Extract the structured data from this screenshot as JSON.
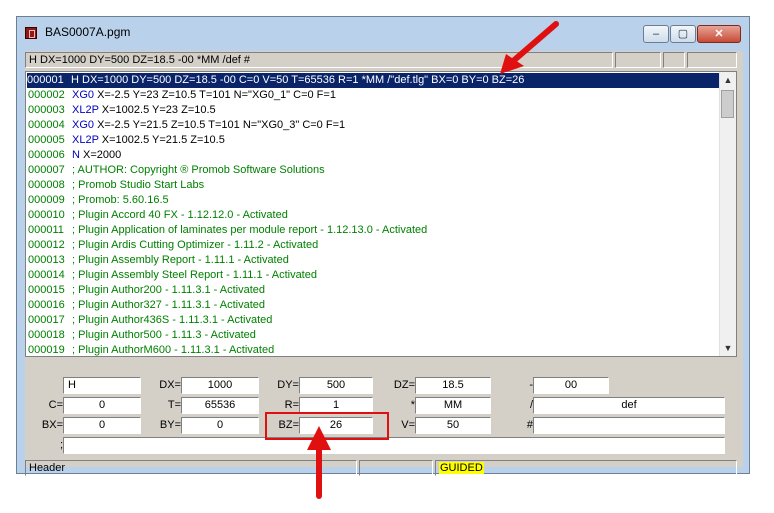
{
  "window": {
    "title": "BAS0007A.pgm",
    "controls": {
      "minimize": "–",
      "maximize": "▢",
      "close": "✕"
    }
  },
  "top_status": {
    "text": "H DX=1000 DY=500 DZ=18.5 -00 *MM /def #"
  },
  "lines": [
    {
      "num": "000001",
      "cmd": "H",
      "rest": "DX=1000 DY=500 DZ=18.5 -00 C=0 V=50 T=65536 R=1 *MM /\"def.tlg\" BX=0 BY=0 BZ=26",
      "selected": true
    },
    {
      "num": "000002",
      "cmd": "XG0",
      "rest": "X=-2.5 Y=23 Z=10.5 T=101 N=\"XG0_1\" C=0 F=1"
    },
    {
      "num": "000003",
      "cmd": "XL2P",
      "rest": "X=1002.5 Y=23 Z=10.5"
    },
    {
      "num": "000004",
      "cmd": "XG0",
      "rest": "X=-2.5 Y=21.5 Z=10.5 T=101 N=\"XG0_3\" C=0 F=1"
    },
    {
      "num": "000005",
      "cmd": "XL2P",
      "rest": "X=1002.5 Y=21.5 Z=10.5"
    },
    {
      "num": "000006",
      "cmd": "N",
      "rest": "X=2000"
    },
    {
      "num": "000007",
      "comment": "; AUTHOR: Copyright ® Promob Software Solutions"
    },
    {
      "num": "000008",
      "comment": "; Promob Studio Start Labs"
    },
    {
      "num": "000009",
      "comment": "; Promob: 5.60.16.5"
    },
    {
      "num": "000010",
      "comment": "; Plugin Accord 40 FX - 1.12.12.0 - Activated"
    },
    {
      "num": "000011",
      "comment": "; Plugin Application of laminates per module report - 1.12.13.0 - Activated"
    },
    {
      "num": "000012",
      "comment": "; Plugin Ardis Cutting Optimizer - 1.11.2 - Activated"
    },
    {
      "num": "000013",
      "comment": "; Plugin Assembly Report - 1.11.1 - Activated"
    },
    {
      "num": "000014",
      "comment": "; Plugin Assembly Steel Report - 1.11.1 - Activated"
    },
    {
      "num": "000015",
      "comment": "; Plugin Author200 - 1.11.3.1 - Activated"
    },
    {
      "num": "000016",
      "comment": "; Plugin Author327 - 1.11.3.1 - Activated"
    },
    {
      "num": "000017",
      "comment": "; Plugin Author436S - 1.11.3.1 - Activated"
    },
    {
      "num": "000018",
      "comment": "; Plugin Author500 - 1.11.3 - Activated"
    },
    {
      "num": "000019",
      "comment": "; Plugin AuthorM600 - 1.11.3.1 - Activated"
    }
  ],
  "fields": {
    "h_value": "H",
    "dx_label": "DX=",
    "dx_value": "1000",
    "dy_label": "DY=",
    "dy_value": "500",
    "dz_label": "DZ=",
    "dz_value": "18.5",
    "minus_label": "-",
    "minus_value": "00",
    "c_label": "C=",
    "c_value": "0",
    "t_label": "T=",
    "t_value": "65536",
    "r_label": "R=",
    "r_value": "1",
    "star_label": "*",
    "star_value": "MM",
    "slash_label": "/",
    "slash_value": "def",
    "bx_label": "BX=",
    "bx_value": "0",
    "by_label": "BY=",
    "by_value": "0",
    "bz_label": "BZ=",
    "bz_value": "26",
    "v_label": "V=",
    "v_value": "50",
    "hash_label": "#",
    "hash_value": "",
    "semicolon_label": ";",
    "semicolon_value": ""
  },
  "bottom_status": {
    "left": "Header",
    "mode": "GUIDED"
  },
  "annotation_color": "#e01010",
  "icons": {
    "scroll_up": "▲",
    "scroll_down": "▼"
  }
}
